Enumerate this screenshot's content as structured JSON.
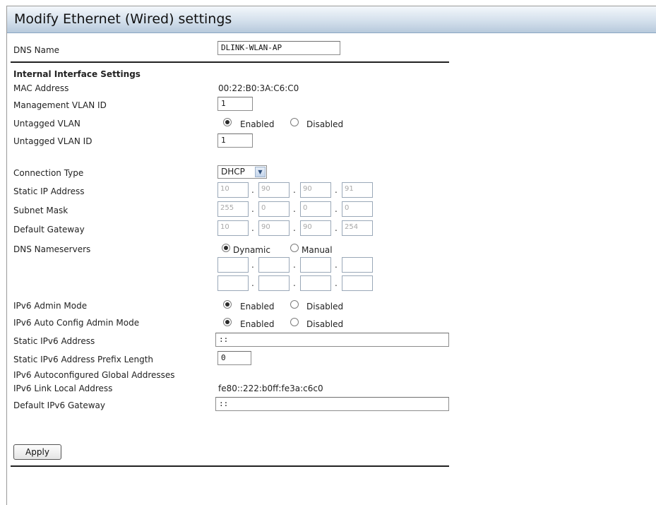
{
  "page": {
    "title": "Modify Ethernet (Wired) settings"
  },
  "dns_name": {
    "label": "DNS Name",
    "value": "DLINK-WLAN-AP"
  },
  "internal": {
    "heading": "Internal Interface Settings",
    "mac": {
      "label": "MAC Address",
      "value": "00:22:B0:3A:C6:C0"
    },
    "mgmt_vlan": {
      "label": "Management VLAN ID",
      "value": "1"
    },
    "untagged_vlan": {
      "label": "Untagged VLAN",
      "enabled_label": "Enabled",
      "disabled_label": "Disabled",
      "selected": "Enabled"
    },
    "untagged_vlan_id": {
      "label": "Untagged VLAN ID",
      "value": "1"
    },
    "connection_type": {
      "label": "Connection Type",
      "value": "DHCP"
    },
    "static_ip": {
      "label": "Static IP Address",
      "octets": [
        "10",
        "90",
        "90",
        "91"
      ]
    },
    "subnet_mask": {
      "label": "Subnet Mask",
      "octets": [
        "255",
        "0",
        "0",
        "0"
      ]
    },
    "gateway": {
      "label": "Default Gateway",
      "octets": [
        "10",
        "90",
        "90",
        "254"
      ]
    },
    "dns_servers": {
      "label": "DNS Nameservers",
      "dynamic_label": "Dynamic",
      "manual_label": "Manual",
      "selected": "Dynamic",
      "server1": [
        "",
        "",
        "",
        ""
      ],
      "server2": [
        "",
        "",
        "",
        ""
      ]
    },
    "ipv6_admin": {
      "label": "IPv6 Admin Mode",
      "enabled_label": "Enabled",
      "disabled_label": "Disabled",
      "selected": "Enabled"
    },
    "ipv6_autoconfig": {
      "label": "IPv6 Auto Config Admin Mode",
      "enabled_label": "Enabled",
      "disabled_label": "Disabled",
      "selected": "Enabled"
    },
    "static_ipv6": {
      "label": "Static IPv6 Address",
      "value": "::"
    },
    "ipv6_prefix": {
      "label": "Static IPv6 Address Prefix Length",
      "value": "0"
    },
    "ipv6_auto_global": {
      "label": "IPv6 Autoconfigured Global Addresses"
    },
    "ipv6_link_local": {
      "label": "IPv6 Link Local Address",
      "value": "fe80::222:b0ff:fe3a:c6c0"
    },
    "ipv6_gateway": {
      "label": "Default IPv6 Gateway",
      "value": "::"
    }
  },
  "actions": {
    "apply_label": "Apply"
  }
}
